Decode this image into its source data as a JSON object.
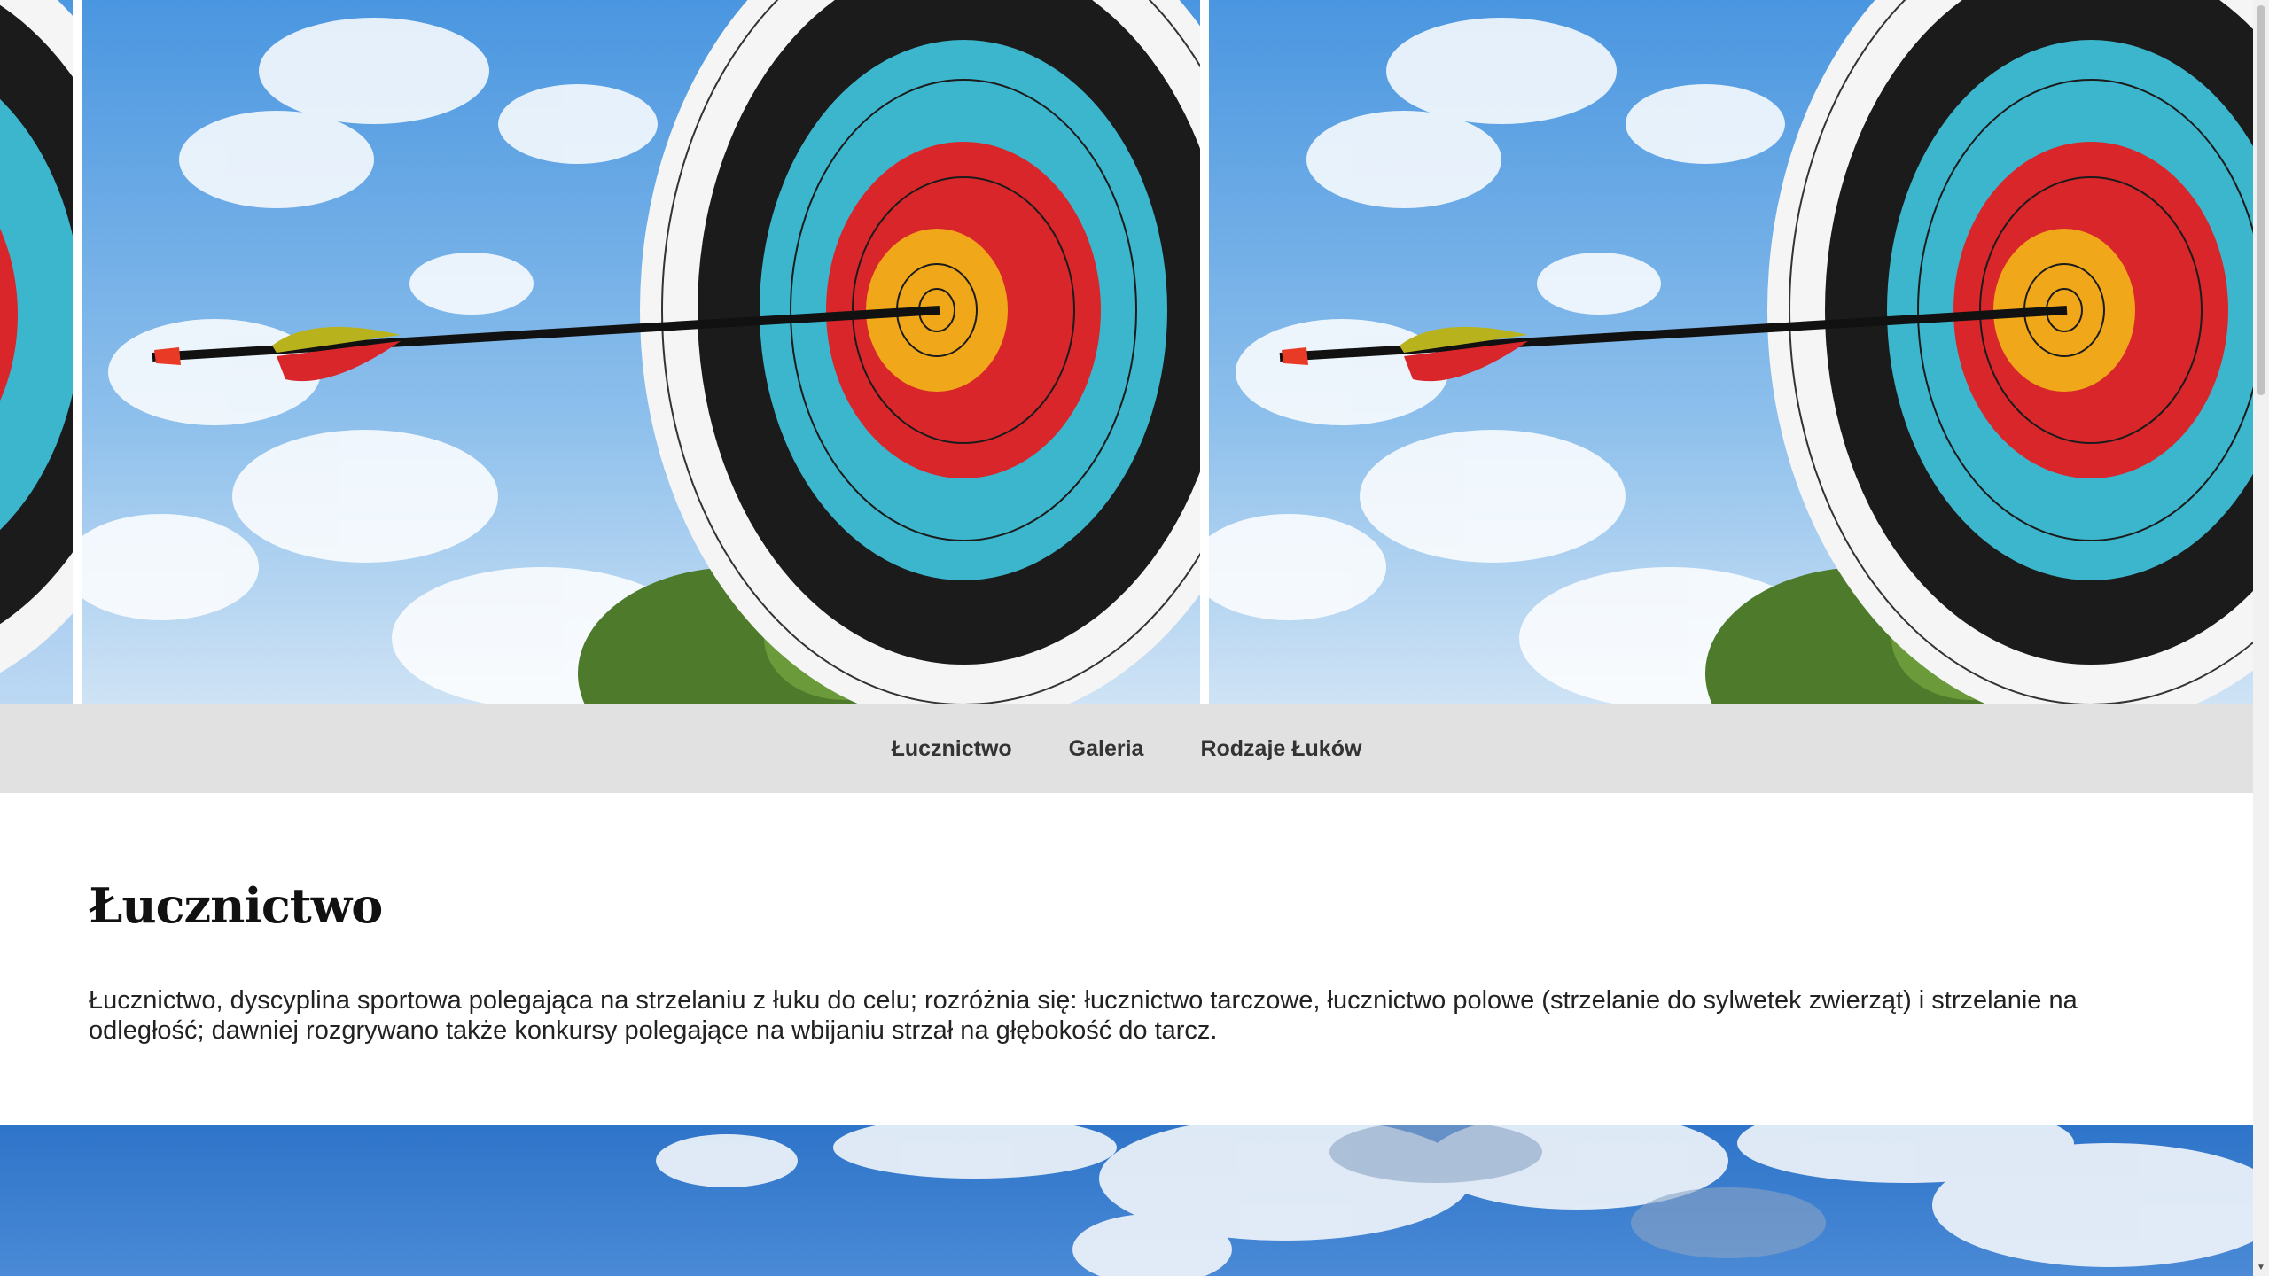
{
  "hero": {
    "image": "archery-target-with-arrow",
    "colors": {
      "sky": "#5fa6e6",
      "target_black": "#1b1b1b",
      "target_blue": "#3bb6cd",
      "target_red": "#d8262a",
      "target_gold": "#f0a81a"
    }
  },
  "nav": {
    "items": [
      {
        "label": "Łucznictwo"
      },
      {
        "label": "Galeria"
      },
      {
        "label": "Rodzaje Łuków"
      }
    ],
    "background": "#e1e1e1"
  },
  "main": {
    "title": "Łucznictwo",
    "body": "Łucznictwo, dyscyplina sportowa polegająca na strzelaniu z łuku do celu; rozróżnia się: łucznictwo tarczowe, łucznictwo polowe (strzelanie do sylwetek zwierząt) i strzelanie na odległość; dawniej rozgrywano także konkursy polegające na wbijaniu strzał na głębokość do tarcz."
  },
  "footer_image": "sky-with-clouds"
}
